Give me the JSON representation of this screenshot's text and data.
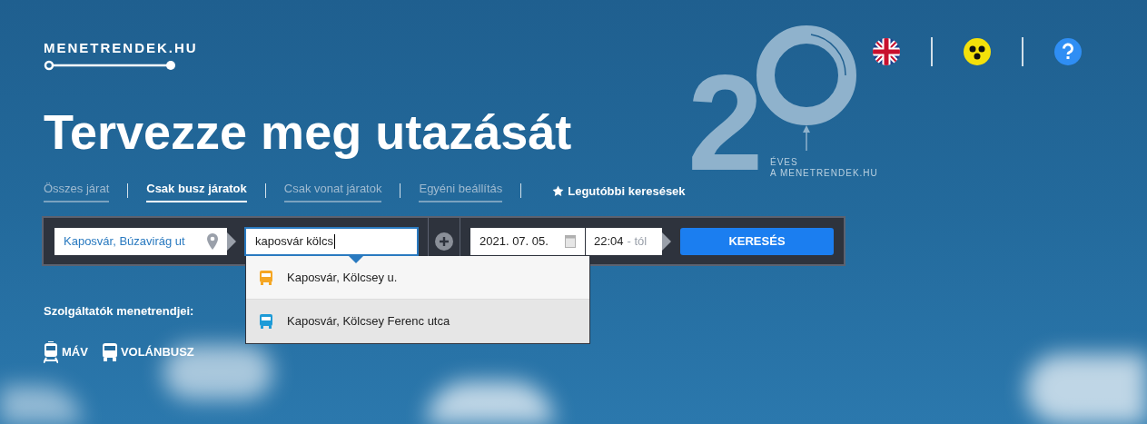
{
  "logo": {
    "text": "MENETRENDEK.HU"
  },
  "anniversary": {
    "digit": "2",
    "line_1": "ÉVES",
    "line_2": "A MENETRENDEK.HU"
  },
  "header_icons": [
    {
      "kind": "english"
    },
    {
      "kind": "accessibility"
    },
    {
      "kind": "help"
    }
  ],
  "headline": "Tervezze meg utazását",
  "tabs": [
    {
      "label": "Összes járat",
      "selected": false
    },
    {
      "label": "Csak busz járatok",
      "selected": true
    },
    {
      "label": "Csak vonat járatok",
      "selected": false
    },
    {
      "label": "Egyéni beállítás",
      "selected": false
    }
  ],
  "recent_searches": "Legutóbbi keresések",
  "search": {
    "from": "Kaposvár, Búzavirág ut",
    "to": "kaposvár kölcs",
    "date": "2021. 07. 05.",
    "time": "22:04",
    "time_suffix": "- tól",
    "button": "KERESÉS"
  },
  "suggestions": [
    {
      "label": "Kaposvár, Kölcsey u.",
      "color": "#f5a623",
      "selected": false
    },
    {
      "label": "Kaposvár, Kölcsey Ferenc utca",
      "color": "#1e9bd7",
      "selected": true
    }
  ],
  "providers_label": "Szolgáltatók menetrendjei:",
  "providers": [
    {
      "label": "MÁV",
      "kind": "train"
    },
    {
      "label": "VOLÁNBUSZ",
      "kind": "bus"
    }
  ]
}
